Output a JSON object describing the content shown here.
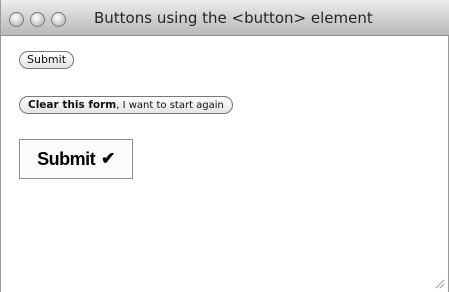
{
  "window": {
    "title": "Buttons using the <button> element"
  },
  "buttons": {
    "submit_small": "Submit",
    "clear_bold": "Clear this form",
    "clear_rest": ", I want to start again",
    "submit_big": "Submit",
    "submit_big_icon": "checkmark-icon"
  }
}
